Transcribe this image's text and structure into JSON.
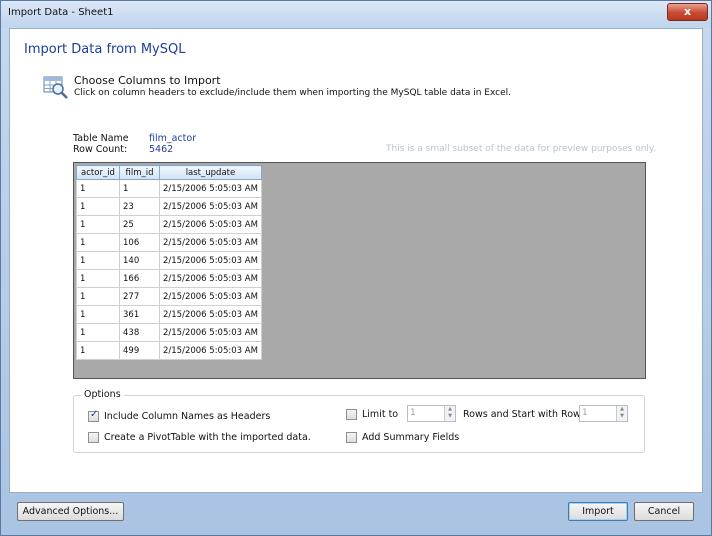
{
  "window": {
    "title": "Import Data - Sheet1",
    "close_glyph": "x"
  },
  "header": {
    "heading": "Import Data from MySQL",
    "choose_title": "Choose Columns to Import",
    "choose_desc": "Click on column headers to exclude/include them when importing the MySQL table data in Excel.",
    "icon": "database-table-icon"
  },
  "table_info": {
    "table_name_label": "Table Name",
    "table_name": "film_actor",
    "row_count_label": "Row Count:",
    "row_count": "5462",
    "preview_note": "This is a small subset of the data for preview purposes only."
  },
  "grid": {
    "columns": [
      "actor_id",
      "film_id",
      "last_update"
    ],
    "rows": [
      [
        "1",
        "1",
        "2/15/2006 5:05:03 AM"
      ],
      [
        "1",
        "23",
        "2/15/2006 5:05:03 AM"
      ],
      [
        "1",
        "25",
        "2/15/2006 5:05:03 AM"
      ],
      [
        "1",
        "106",
        "2/15/2006 5:05:03 AM"
      ],
      [
        "1",
        "140",
        "2/15/2006 5:05:03 AM"
      ],
      [
        "1",
        "166",
        "2/15/2006 5:05:03 AM"
      ],
      [
        "1",
        "277",
        "2/15/2006 5:05:03 AM"
      ],
      [
        "1",
        "361",
        "2/15/2006 5:05:03 AM"
      ],
      [
        "1",
        "438",
        "2/15/2006 5:05:03 AM"
      ],
      [
        "1",
        "499",
        "2/15/2006 5:05:03 AM"
      ]
    ]
  },
  "options": {
    "legend": "Options",
    "include_headers": {
      "label": "Include Column Names as Headers",
      "checked": true
    },
    "pivot_table": {
      "label": "Create a PivotTable with the imported data.",
      "checked": false
    },
    "limit_to": {
      "label": "Limit to",
      "checked": false,
      "value": "1"
    },
    "rows_start_label": "Rows and Start with Row",
    "start_row_value": "1",
    "summary_fields": {
      "label": "Add Summary Fields",
      "checked": false
    }
  },
  "buttons": {
    "advanced": "Advanced Options...",
    "import": "Import",
    "cancel": "Cancel"
  },
  "colors": {
    "accent": "#1e3f99",
    "grid_background": "#a9a9a9",
    "close_button": "#c8492f"
  }
}
